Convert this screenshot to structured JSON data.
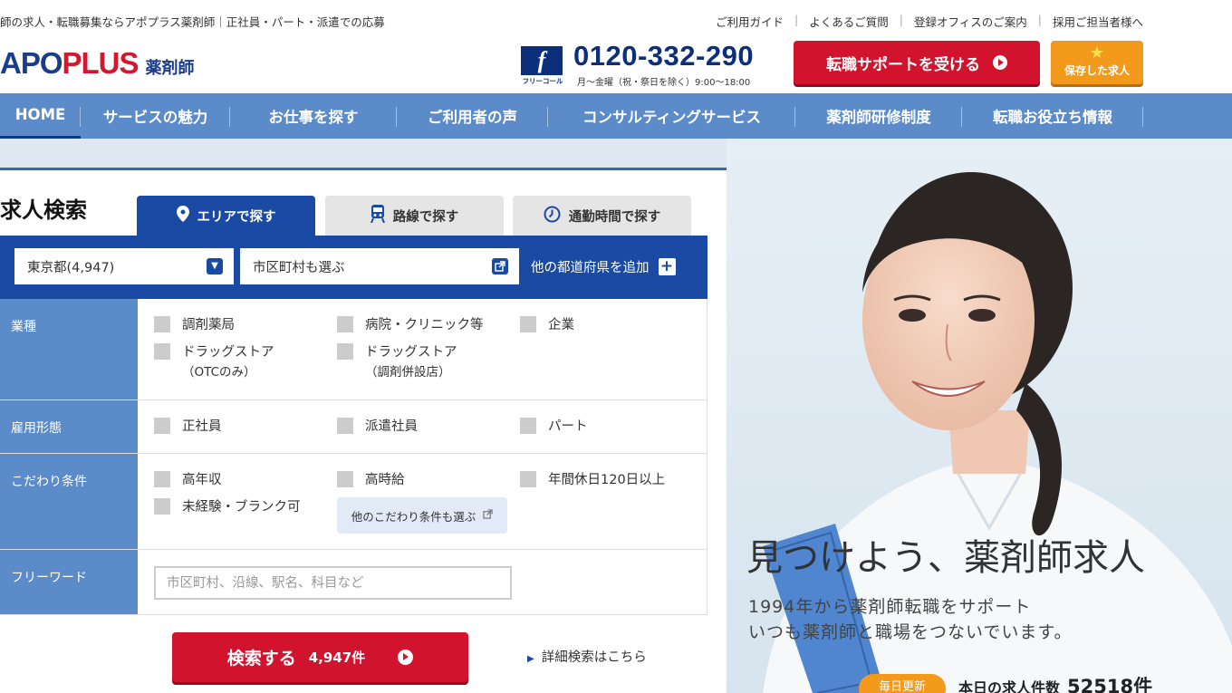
{
  "header": {
    "tagline": "師の求人・転職募集ならアポプラス薬剤師｜正社員・パート・派遣での応募",
    "top_links": [
      "ご利用ガイド",
      "よくあるご質問",
      "登録オフィスのご案内",
      "採用ご担当者様へ"
    ],
    "logo_main_prefix": "APO",
    "logo_main_suffix": "PLUS",
    "logo_sub": "薬剤師",
    "freecall_caption": "フリーコール",
    "freecall_mark": "f",
    "phone": "0120-332-290",
    "phone_hours": "月～金曜（祝・祭日を除く）9:00～18:00",
    "support_button": "転職サポートを受ける",
    "saved_button": "保存した求人"
  },
  "nav": {
    "items": [
      "HOME",
      "サービスの魅力",
      "お仕事を探す",
      "ご利用者の声",
      "コンサルティングサービス",
      "薬剤師研修制度",
      "転職お役立ち情報"
    ]
  },
  "search": {
    "title": "求人検索",
    "tabs": [
      "エリアで探す",
      "路線で探す",
      "通勤時間で探す"
    ],
    "prefecture_value": "東京都(4,947)",
    "city_value": "市区町村も選ぶ",
    "add_prefecture": "他の都道府県を追加",
    "rows": {
      "industry": {
        "label": "業種",
        "options": [
          "調剤薬局",
          "病院・クリニック等",
          "企業",
          "ドラッグストア",
          "（OTCのみ）",
          "ドラッグストア",
          "（調剤併設店）"
        ]
      },
      "employment": {
        "label": "雇用形態",
        "options": [
          "正社員",
          "派遣社員",
          "パート"
        ]
      },
      "conditions": {
        "label": "こだわり条件",
        "options": [
          "高年収",
          "高時給",
          "年間休日120日以上",
          "未経験・ブランク可"
        ],
        "more_button": "他のこだわり条件も選ぶ"
      },
      "freeword": {
        "label": "フリーワード",
        "placeholder": "市区町村、沿線、駅名、科目など"
      }
    },
    "search_button": "検索する",
    "search_count": "4,947件",
    "detail_link": "詳細検索はこちら"
  },
  "hero": {
    "headline": "見つけよう、薬剤師求人",
    "sub_line1": "1994年から薬剤師転職をサポート",
    "sub_line2": "いつも薬剤師と職場をつないでいます。",
    "daily_badge": "毎日更新",
    "job_count_label": "本日の求人件数",
    "job_count_value": "52518件"
  },
  "colors": {
    "brand_navy": "#1a3c8c",
    "brand_red": "#d1132d",
    "nav_blue": "#5b8bc8",
    "tab_blue": "#1a4aa3",
    "accent_orange": "#f39a1c"
  }
}
